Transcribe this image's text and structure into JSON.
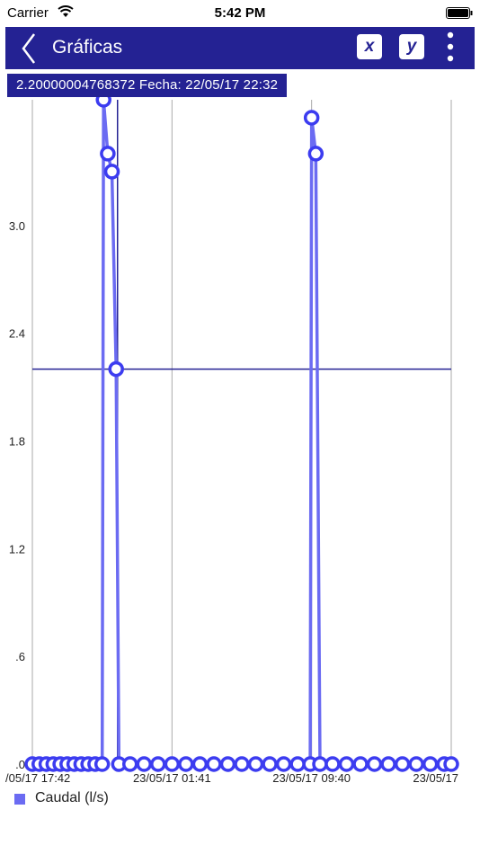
{
  "status_bar": {
    "carrier": "Carrier",
    "time": "5:42 PM"
  },
  "nav": {
    "title": "Gráficas",
    "x_label": "x",
    "y_label": "y"
  },
  "tooltip": {
    "text": "2.20000004768372 Fecha: 22/05/17 22:32"
  },
  "colors": {
    "nav": "#242293",
    "series": "#6b6bf2",
    "marker": "#3c3cf0",
    "grid": "#aaaaaa"
  },
  "chart_data": {
    "type": "line",
    "ylim": [
      0,
      3.7
    ],
    "y_ticks": [
      ".0",
      ".6",
      "1.2",
      "1.8",
      "2.4",
      "3.0"
    ],
    "y_tick_values": [
      0,
      0.6,
      1.2,
      1.8,
      2.4,
      3.0
    ],
    "x_ticks": [
      "/05/17 17:42",
      "23/05/17 01:41",
      "23/05/17 09:40",
      "23/05/17"
    ],
    "x_tick_index": [
      0,
      1,
      2,
      3
    ],
    "series": [
      {
        "name": "Caudal (l/s)",
        "points": [
          {
            "x": 0.0,
            "y": 0
          },
          {
            "x": 0.05,
            "y": 0
          },
          {
            "x": 0.1,
            "y": 0
          },
          {
            "x": 0.15,
            "y": 0
          },
          {
            "x": 0.2,
            "y": 0
          },
          {
            "x": 0.25,
            "y": 0
          },
          {
            "x": 0.3,
            "y": 0
          },
          {
            "x": 0.35,
            "y": 0
          },
          {
            "x": 0.4,
            "y": 0
          },
          {
            "x": 0.45,
            "y": 0
          },
          {
            "x": 0.5,
            "y": 0
          },
          {
            "x": 0.51,
            "y": 3.7
          },
          {
            "x": 0.54,
            "y": 3.4
          },
          {
            "x": 0.57,
            "y": 3.3
          },
          {
            "x": 0.6,
            "y": 2.2
          },
          {
            "x": 0.62,
            "y": 0
          },
          {
            "x": 0.7,
            "y": 0
          },
          {
            "x": 0.8,
            "y": 0
          },
          {
            "x": 0.9,
            "y": 0
          },
          {
            "x": 1.0,
            "y": 0
          },
          {
            "x": 1.1,
            "y": 0
          },
          {
            "x": 1.2,
            "y": 0
          },
          {
            "x": 1.3,
            "y": 0
          },
          {
            "x": 1.4,
            "y": 0
          },
          {
            "x": 1.5,
            "y": 0
          },
          {
            "x": 1.6,
            "y": 0
          },
          {
            "x": 1.7,
            "y": 0
          },
          {
            "x": 1.8,
            "y": 0
          },
          {
            "x": 1.9,
            "y": 0
          },
          {
            "x": 1.99,
            "y": 0
          },
          {
            "x": 2.0,
            "y": 3.6
          },
          {
            "x": 2.03,
            "y": 3.4
          },
          {
            "x": 2.06,
            "y": 0
          },
          {
            "x": 2.15,
            "y": 0
          },
          {
            "x": 2.25,
            "y": 0
          },
          {
            "x": 2.35,
            "y": 0
          },
          {
            "x": 2.45,
            "y": 0
          },
          {
            "x": 2.55,
            "y": 0
          },
          {
            "x": 2.65,
            "y": 0
          },
          {
            "x": 2.75,
            "y": 0
          },
          {
            "x": 2.85,
            "y": 0
          },
          {
            "x": 2.95,
            "y": 0
          },
          {
            "x": 3.0,
            "y": 0
          }
        ]
      }
    ],
    "crosshair": {
      "x": 0.61,
      "y": 2.2
    },
    "legend": "bottom-left",
    "grid": true
  }
}
